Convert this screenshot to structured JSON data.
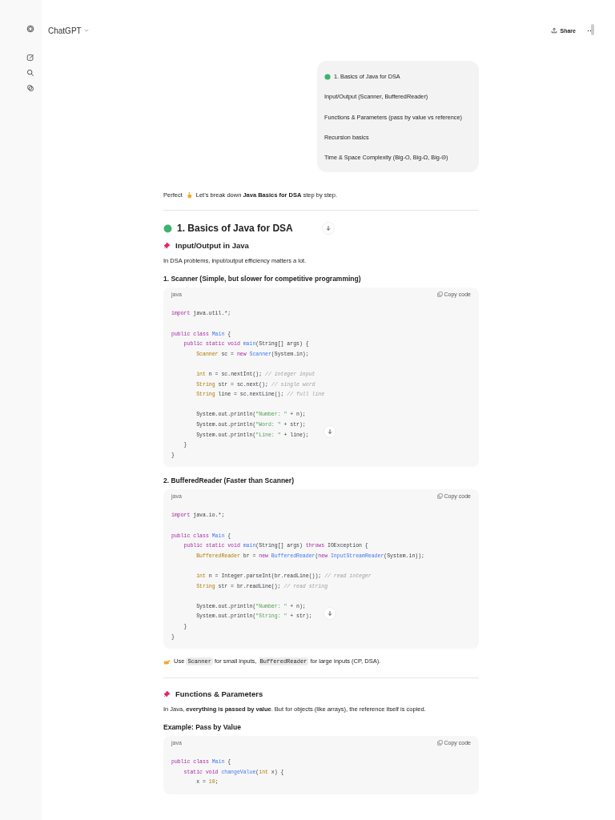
{
  "header": {
    "title": "ChatGPT",
    "share": "Share"
  },
  "user_message": {
    "lines": [
      {
        "text": "1. Basics of Java for DSA",
        "dot": true
      },
      {
        "text": "Input/Output (Scanner, BufferedReader)",
        "dot": false
      },
      {
        "text": "Functions & Parameters (pass by value vs reference)",
        "dot": false
      },
      {
        "text": "Recursion basics",
        "dot": false
      },
      {
        "text": "Time & Space Complexity (Big-O, Big-Ω, Big-Θ)",
        "dot": false
      }
    ]
  },
  "reply": {
    "intro_lead": "Perfect",
    "intro": "Let’s break down **Java Basics for DSA** step by step.",
    "blocks": [
      {
        "kind": "divider"
      },
      {
        "kind": "heading2",
        "text": "1. Basics of Java for DSA"
      },
      {
        "kind": "heading3",
        "text": "Input/Output in Java"
      },
      {
        "kind": "paragraph",
        "text": "In DSA problems, input/output efficiency matters a lot."
      },
      {
        "kind": "heading4",
        "text": "1. Scanner (Simple, but slower for competitive programming)"
      },
      {
        "kind": "code",
        "language": "java",
        "copy": "Copy code",
        "groups": [
          [
            [
              {
                "kind": "keyword",
                "text": "import"
              },
              {
                "kind": "plain",
                "text": " java.util.*;"
              }
            ]
          ],
          [
            [
              {
                "kind": "keyword",
                "text": "public class "
              },
              {
                "kind": "function",
                "text": "Main"
              },
              {
                "kind": "plain",
                "text": " {"
              }
            ],
            [
              {
                "kind": "keyword",
                "text": "    public static void "
              },
              {
                "kind": "function",
                "text": "main"
              },
              {
                "kind": "plain",
                "text": "(String[] args) {"
              }
            ],
            [
              {
                "kind": "type",
                "text": "        Scanner"
              },
              {
                "kind": "plain",
                "text": " sc = "
              },
              {
                "kind": "keyword",
                "text": "new "
              },
              {
                "kind": "function",
                "text": "Scanner"
              },
              {
                "kind": "plain",
                "text": "(System.in);"
              }
            ]
          ],
          [
            [
              {
                "kind": "type",
                "text": "        int"
              },
              {
                "kind": "plain",
                "text": " n = sc.nextInt(); "
              },
              {
                "kind": "comment",
                "text": "// integer input"
              }
            ],
            [
              {
                "kind": "type",
                "text": "        String"
              },
              {
                "kind": "plain",
                "text": " str = sc.next(); "
              },
              {
                "kind": "comment",
                "text": "// single word"
              }
            ],
            [
              {
                "kind": "type",
                "text": "        String"
              },
              {
                "kind": "plain",
                "text": " line = sc.nextLine(); "
              },
              {
                "kind": "comment",
                "text": "// full line"
              }
            ]
          ],
          [
            [
              {
                "kind": "plain",
                "text": "        System.out.println("
              },
              {
                "kind": "string",
                "text": "\"Number: \""
              },
              {
                "kind": "plain",
                "text": " + n);"
              }
            ],
            [
              {
                "kind": "plain",
                "text": "        System.out.println("
              },
              {
                "kind": "string",
                "text": "\"Word: \""
              },
              {
                "kind": "plain",
                "text": " + str);"
              }
            ],
            [
              {
                "kind": "plain",
                "text": "        System.out.println("
              },
              {
                "kind": "string",
                "text": "\"Line: \""
              },
              {
                "kind": "plain",
                "text": " + line);"
              }
            ],
            [
              {
                "kind": "plain",
                "text": "    }"
              }
            ],
            [
              {
                "kind": "plain",
                "text": "}"
              }
            ]
          ]
        ]
      },
      {
        "kind": "heading4",
        "text": "2. BufferedReader (Faster than Scanner)"
      },
      {
        "kind": "code",
        "language": "java",
        "copy": "Copy code",
        "groups": [
          [
            [
              {
                "kind": "keyword",
                "text": "import"
              },
              {
                "kind": "plain",
                "text": " java.io.*;"
              }
            ]
          ],
          [
            [
              {
                "kind": "keyword",
                "text": "public class "
              },
              {
                "kind": "function",
                "text": "Main"
              },
              {
                "kind": "plain",
                "text": " {"
              }
            ],
            [
              {
                "kind": "keyword",
                "text": "    public static void "
              },
              {
                "kind": "function",
                "text": "main"
              },
              {
                "kind": "plain",
                "text": "(String[] args) "
              },
              {
                "kind": "keyword",
                "text": "throws"
              },
              {
                "kind": "plain",
                "text": " IOException {"
              }
            ],
            [
              {
                "kind": "type",
                "text": "        BufferedReader"
              },
              {
                "kind": "plain",
                "text": " br = "
              },
              {
                "kind": "keyword",
                "text": "new "
              },
              {
                "kind": "function",
                "text": "BufferedReader"
              },
              {
                "kind": "plain",
                "text": "("
              },
              {
                "kind": "keyword",
                "text": "new "
              },
              {
                "kind": "function",
                "text": "InputStreamReader"
              },
              {
                "kind": "plain",
                "text": "(System.in));"
              }
            ]
          ],
          [
            [
              {
                "kind": "type",
                "text": "        int"
              },
              {
                "kind": "plain",
                "text": " n = Integer.parseInt(br.readLine()); "
              },
              {
                "kind": "comment",
                "text": "// read integer"
              }
            ],
            [
              {
                "kind": "type",
                "text": "        String"
              },
              {
                "kind": "plain",
                "text": " str = br.readLine(); "
              },
              {
                "kind": "comment",
                "text": "// read string"
              }
            ]
          ],
          [
            [
              {
                "kind": "plain",
                "text": "        System.out.println("
              },
              {
                "kind": "string",
                "text": "\"Number: \""
              },
              {
                "kind": "plain",
                "text": " + n);"
              }
            ],
            [
              {
                "kind": "plain",
                "text": "        System.out.println("
              },
              {
                "kind": "string",
                "text": "\"String: \""
              },
              {
                "kind": "plain",
                "text": " + str);"
              }
            ],
            [
              {
                "kind": "plain",
                "text": "    }"
              }
            ],
            [
              {
                "kind": "plain",
                "text": "}"
              }
            ]
          ]
        ]
      },
      {
        "kind": "tip",
        "parts": [
          {
            "text": "Use ",
            "code": false
          },
          {
            "text": "Scanner",
            "code": true
          },
          {
            "text": " for small inputs, ",
            "code": false
          },
          {
            "text": "BufferedReader",
            "code": true
          },
          {
            "text": " for large inputs (CP, DSA).",
            "code": false
          }
        ]
      },
      {
        "kind": "divider"
      },
      {
        "kind": "heading3",
        "text": "Functions & Parameters"
      },
      {
        "kind": "paragraph",
        "text": "In Java, **everything is passed by value**. But for objects (like arrays), the reference itself is copied."
      },
      {
        "kind": "heading4",
        "text": "Example: Pass by Value"
      },
      {
        "kind": "code",
        "language": "java",
        "copy": "Copy code",
        "groups": [
          [
            [
              {
                "kind": "keyword",
                "text": "public class "
              },
              {
                "kind": "function",
                "text": "Main"
              },
              {
                "kind": "plain",
                "text": " {"
              }
            ],
            [
              {
                "kind": "keyword",
                "text": "    static void "
              },
              {
                "kind": "function",
                "text": "changeValue"
              },
              {
                "kind": "plain",
                "text": "("
              },
              {
                "kind": "type",
                "text": "int"
              },
              {
                "kind": "plain",
                "text": " x) {"
              }
            ],
            [
              {
                "kind": "plain",
                "text": "        x = "
              },
              {
                "kind": "type",
                "text": "10"
              },
              {
                "kind": "plain",
                "text": ";"
              }
            ]
          ]
        ]
      }
    ]
  }
}
